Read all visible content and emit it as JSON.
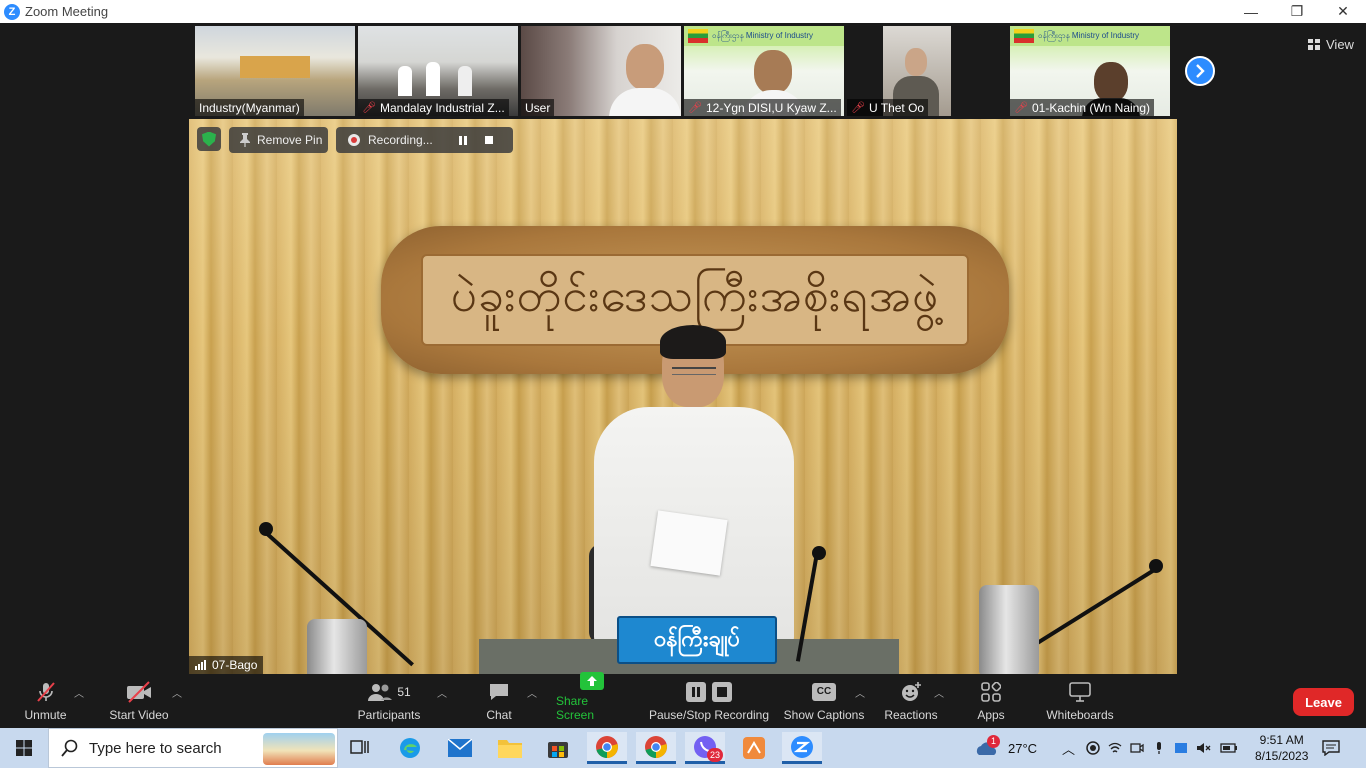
{
  "window": {
    "title": "Zoom Meeting",
    "controls": {
      "minimize": "—",
      "restore": "❐",
      "close": "✕"
    }
  },
  "thumbnails": [
    {
      "name": "Industry(Myanmar)",
      "muted": false
    },
    {
      "name": "Mandalay Industrial Z...",
      "muted": true
    },
    {
      "name": "User",
      "muted": false
    },
    {
      "name": "12-Ygn DISI,U Kyaw Z...",
      "muted": true
    },
    {
      "name": "U Thet Oo",
      "muted": true
    },
    {
      "name": "01-Kachin (Wn Naing)",
      "muted": true
    }
  ],
  "thumb_banner_text": "ဝန်ကြီးဌာန Ministry of Industry",
  "view_button": {
    "label": "View",
    "icon": "grid-icon"
  },
  "main_video": {
    "sign_text": "ပဲခူးတိုင်းဒေသကြီးအစိုးရအဖွဲ့",
    "nameplate_text": "ဝန်ကြီးချုပ်",
    "speaker_name": "07-Bago",
    "remove_pin_label": "Remove Pin",
    "recording_label": "Recording..."
  },
  "toolbar": {
    "unmute": "Unmute",
    "start_video": "Start Video",
    "participants": "Participants",
    "participants_count": "51",
    "chat": "Chat",
    "share_screen": "Share Screen",
    "pause_stop_recording": "Pause/Stop Recording",
    "show_captions": "Show Captions",
    "captions_badge": "CC",
    "reactions": "Reactions",
    "apps": "Apps",
    "whiteboards": "Whiteboards",
    "leave": "Leave"
  },
  "taskbar": {
    "search_placeholder": "Type here to search",
    "viber_badge": "23",
    "weather_badge": "1",
    "temperature": "27°C",
    "time": "9:51 AM",
    "date": "8/15/2023"
  },
  "colors": {
    "zoom_blue": "#2d8cff",
    "share_green": "#23c33a",
    "leave_red": "#e02828",
    "muted_red": "#e8404a",
    "taskbar_bg": "#c8d9ee"
  }
}
